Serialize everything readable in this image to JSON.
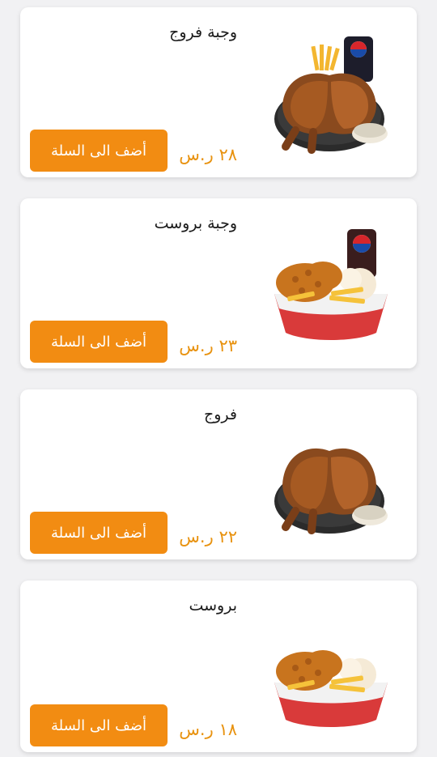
{
  "menu": {
    "items": [
      {
        "title": "وجبة فروج",
        "price": "٢٨ ر.س",
        "add_button": "أضف الى السلة",
        "image": "chicken-meal-with-pepsi-and-fries"
      },
      {
        "title": "وجبة بروست",
        "price": "٢٣ ر.س",
        "add_button": "أضف الى السلة",
        "image": "broast-meal-with-pepsi"
      },
      {
        "title": "فروج",
        "price": "٢٢ ر.س",
        "add_button": "أضف الى السلة",
        "image": "grilled-chicken"
      },
      {
        "title": "بروست",
        "price": "١٨ ر.س",
        "add_button": "أضف الى السلة",
        "image": "broast-fried-chicken"
      }
    ]
  },
  "colors": {
    "accent": "#f28c12",
    "price": "#e8920f",
    "card": "#ffffff",
    "background": "#f1f1f3"
  }
}
